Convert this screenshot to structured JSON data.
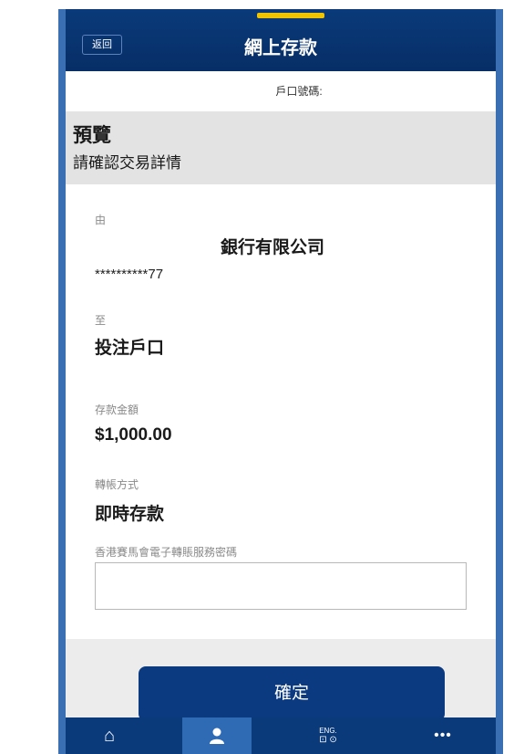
{
  "header": {
    "back_label": "返回",
    "title": "網上存款",
    "accent_color": "#f0c400",
    "bar_color": "#0a3a7a"
  },
  "account": {
    "label": "戶口號碼:"
  },
  "preview": {
    "title": "預覽",
    "subtitle": "請確認交易詳情"
  },
  "details": {
    "from_label": "由",
    "bank_name": "銀行有限公司",
    "masked_account": "**********77",
    "to_label": "至",
    "to_value": "投注戶口",
    "amount_label": "存款金額",
    "amount_value": "$1,000.00",
    "method_label": "轉帳方式",
    "method_value": "即時存款",
    "password_label": "香港賽馬會電子轉賬服務密碼",
    "password_value": ""
  },
  "actions": {
    "confirm_label": "確定"
  },
  "tabbar": {
    "items": [
      {
        "icon": "home-icon",
        "glyph": "⌂"
      },
      {
        "icon": "user-icon",
        "glyph": "●"
      },
      {
        "icon": "language-icon",
        "glyph": "ENG."
      },
      {
        "icon": "more-icon",
        "glyph": "•••"
      }
    ]
  }
}
